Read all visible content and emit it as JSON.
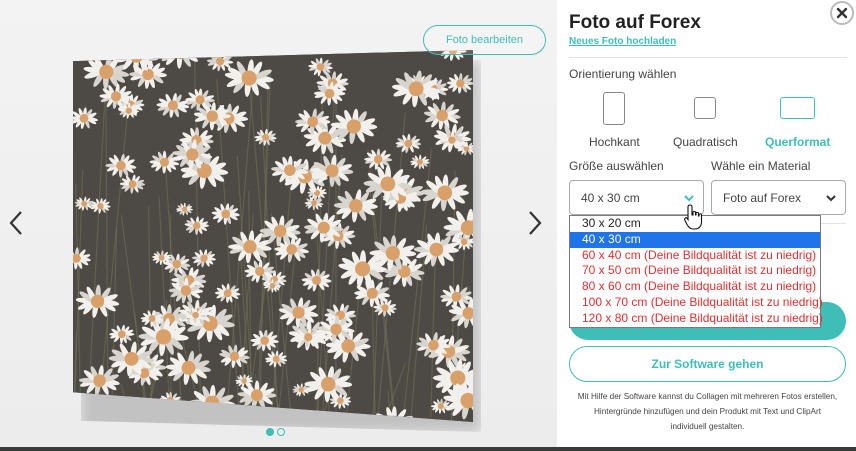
{
  "preview": {
    "edit_button": "Foto bearbeiten",
    "prev_icon": "chevron-left-icon",
    "next_icon": "chevron-right-icon",
    "image_subject": "photo-of-chamomile-flowers",
    "slides": [
      {
        "active": true
      },
      {
        "active": false
      }
    ]
  },
  "panel": {
    "title": "Foto auf Forex",
    "upload_link": "Neues Foto hochladen",
    "close_icon": "close-icon",
    "orientation_label": "Orientierung wählen",
    "orientations": [
      {
        "label": "Hochkant",
        "active": false
      },
      {
        "label": "Quadratisch",
        "active": false
      },
      {
        "label": "Querformat",
        "active": true
      }
    ],
    "size_label": "Größe auswählen",
    "material_label": "Wähle ein Material",
    "size_value": "40 x 30 cm",
    "material_value": "Foto auf Forex",
    "size_options": [
      {
        "label": "30 x 20 cm",
        "state": "normal"
      },
      {
        "label": "40 x 30 cm",
        "state": "selected"
      },
      {
        "label": "60 x 40 cm (Deine Bildqualität ist zu niedrig)",
        "state": "warn"
      },
      {
        "label": "70 x 50 cm (Deine Bildqualität ist zu niedrig)",
        "state": "warn"
      },
      {
        "label": "80 x 60 cm (Deine Bildqualität ist zu niedrig)",
        "state": "warn"
      },
      {
        "label": "100 x 70 cm (Deine Bildqualität ist zu niedrig)",
        "state": "warn"
      },
      {
        "label": "120 x 80 cm (Deine Bildqualität ist zu niedrig)",
        "state": "warn"
      }
    ],
    "software_button": "Zur Software gehen",
    "help_text": "Mit Hilfe der Software kannst du Collagen mit mehreren Fotos erstellen, Hintergründe hinzufügen und dein Produkt mit Text und ClipArt individuell gestalten."
  },
  "colors": {
    "accent": "#3fbdb7",
    "warning": "#e03030",
    "selected_option": "#1e74e8"
  }
}
